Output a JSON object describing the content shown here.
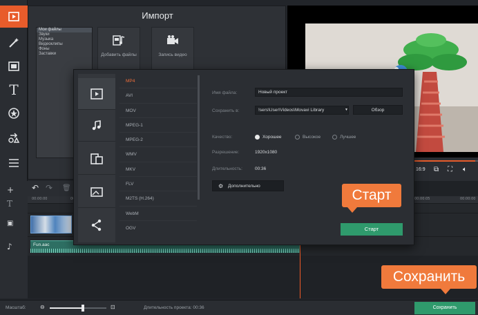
{
  "import_panel": {
    "title": "Импорт",
    "list": [
      "Мои файлы",
      "Звуки",
      "Музыка",
      "Видеоклипы",
      "Фоны",
      "Заставки"
    ],
    "add_files": "Добавить файлы",
    "record_video": "Запись видео"
  },
  "player": {
    "aspect": "16:9"
  },
  "timeline": {
    "ruler_ticks": [
      "00:00:00",
      "00",
      "00:00:05",
      "00:00:00"
    ],
    "audio_clip_name": "Fun.aac"
  },
  "status": {
    "scale_label": "Масштаб:",
    "duration_label": "Длительность проекта: 00:36",
    "save_button": "Сохранить"
  },
  "dialog": {
    "formats": [
      "MP4",
      "AVI",
      "MOV",
      "MPEG-1",
      "MPEG-2",
      "WMV",
      "MKV",
      "FLV",
      "M2TS (H.264)",
      "WebM",
      "OGV"
    ],
    "selected_format": "MP4",
    "filename_label": "Имя файла:",
    "filename_value": "Новый проект",
    "save_to_label": "Сохранить в:",
    "save_to_value": "!sers\\User\\Videos\\Movavi Library",
    "browse_button": "Обзор",
    "quality_label": "Качество:",
    "quality_options": [
      "Хорошее",
      "Высокое",
      "Лучшее"
    ],
    "quality_selected": "Хорошее",
    "resolution_label": "Разрешение:",
    "resolution_value": "1920x1080",
    "duration_label": "Длительность:",
    "duration_value": "00:36",
    "advanced_button": "Дополнительно",
    "start_button": "Старт"
  },
  "callouts": {
    "start": "Старт",
    "save": "Сохранить"
  },
  "colors": {
    "accent": "#e85c2b",
    "callout": "#f07a3c",
    "green_button": "#2f9a6c"
  }
}
